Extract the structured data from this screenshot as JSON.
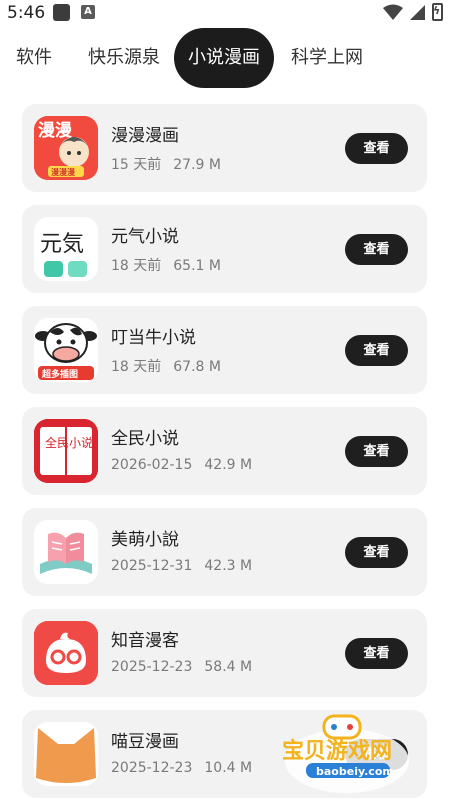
{
  "status_bar": {
    "time": "5:46",
    "notification_letter": "A",
    "battery_symbol": "ϟ"
  },
  "tabs": [
    {
      "label": "软件",
      "active": false
    },
    {
      "label": "快乐源泉",
      "active": false
    },
    {
      "label": "小说漫画",
      "active": true
    },
    {
      "label": "科学上网",
      "active": false
    }
  ],
  "apps": [
    {
      "name": "漫漫漫画",
      "date": "15 天前",
      "size": "27.9 M",
      "icon": "manman-manga-icon",
      "button": "查看"
    },
    {
      "name": "元气小说",
      "date": "18 天前",
      "size": "65.1 M",
      "icon": "yuanqi-novel-icon",
      "button": "查看"
    },
    {
      "name": "叮当牛小说",
      "date": "18 天前",
      "size": "67.8 M",
      "icon": "cow-novel-icon",
      "button": "查看"
    },
    {
      "name": "全民小说",
      "date": "2026-02-15",
      "size": "42.9 M",
      "icon": "quanmin-novel-icon",
      "button": "查看"
    },
    {
      "name": "美萌小說",
      "date": "2025-12-31",
      "size": "42.3 M",
      "icon": "book-icon",
      "button": "查看"
    },
    {
      "name": "知音漫客",
      "date": "2025-12-23",
      "size": "58.4 M",
      "icon": "zhiyin-manke-icon",
      "button": "查看"
    },
    {
      "name": "喵豆漫画",
      "date": "2025-12-23",
      "size": "10.4 M",
      "icon": "cat-ears-icon",
      "button": "查看"
    }
  ],
  "icon_text": {
    "manman_title": "漫漫",
    "manman_badge": "漫漫漫",
    "yuanqi": "元気",
    "cow_banner": "超多插图",
    "quanmin_left": "全民",
    "quanmin_right": "小说"
  },
  "watermark": {
    "title": "宝贝游戏网",
    "url": "baobeiy.com"
  }
}
